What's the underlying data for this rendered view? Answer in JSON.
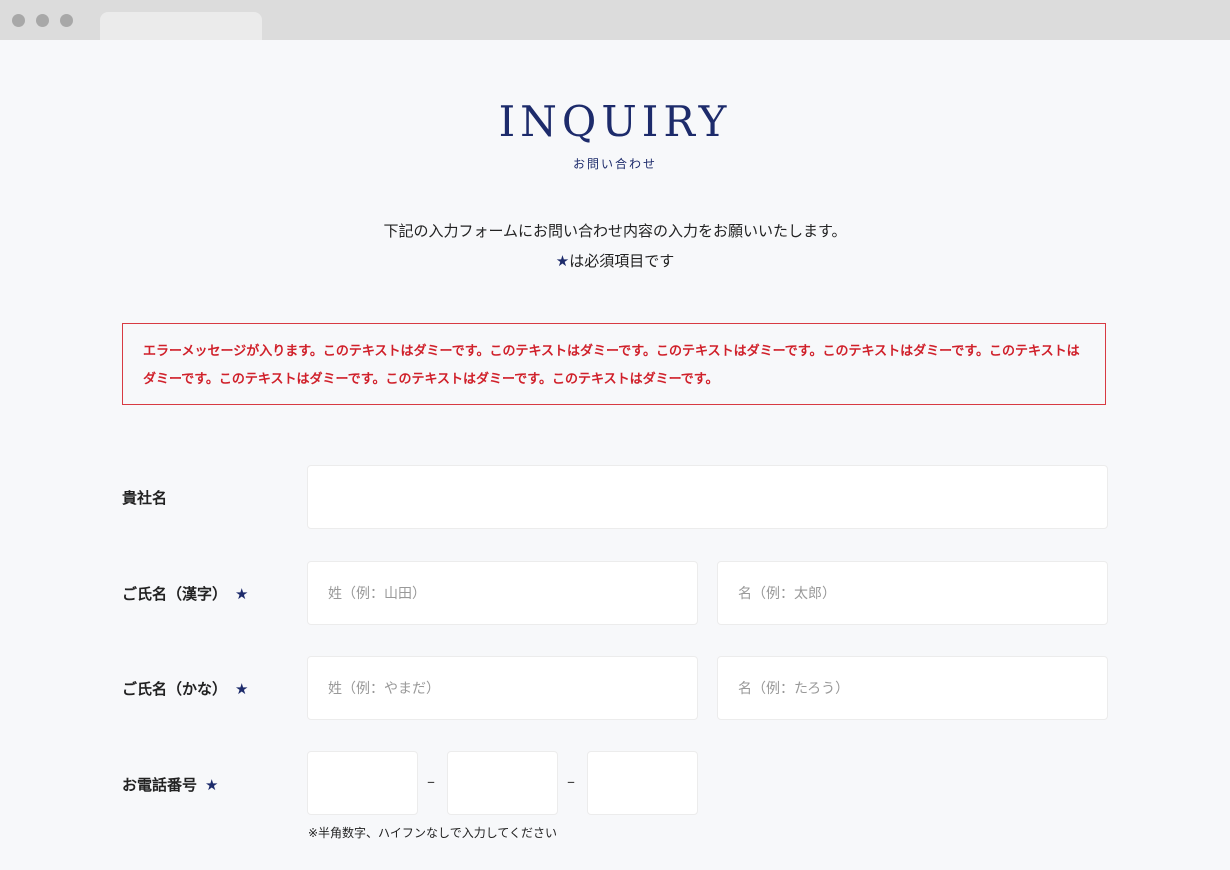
{
  "page": {
    "title": "INQUIRY",
    "subtitle": "お問い合わせ",
    "intro_line1": "下記の入力フォームにお問い合わせ内容の入力をお願いいたします。",
    "required_star": "★",
    "intro_line2_suffix": "は必須項目です"
  },
  "error": {
    "message": "エラーメッセージが入ります。このテキストはダミーです。このテキストはダミーです。このテキストはダミーです。このテキストはダミーです。このテキストはダミーです。このテキストはダミーです。このテキストはダミーです。このテキストはダミーです。"
  },
  "form": {
    "company": {
      "label": "貴社名",
      "value": ""
    },
    "name_kanji": {
      "label": "ご氏名（漢字）",
      "star": "★",
      "last_placeholder": "姓（例：山田）",
      "first_placeholder": "名（例：太郎）"
    },
    "name_kana": {
      "label": "ご氏名（かな）",
      "star": "★",
      "last_placeholder": "姓（例：やまだ）",
      "first_placeholder": "名（例：たろう）"
    },
    "phone": {
      "label": "お電話番号",
      "star": "★",
      "separator": "–",
      "note": "※半角数字、ハイフンなしで入力してください"
    }
  },
  "colors": {
    "brand": "#1d2b6b",
    "error": "#d0202a",
    "background": "#f7f8fa"
  }
}
